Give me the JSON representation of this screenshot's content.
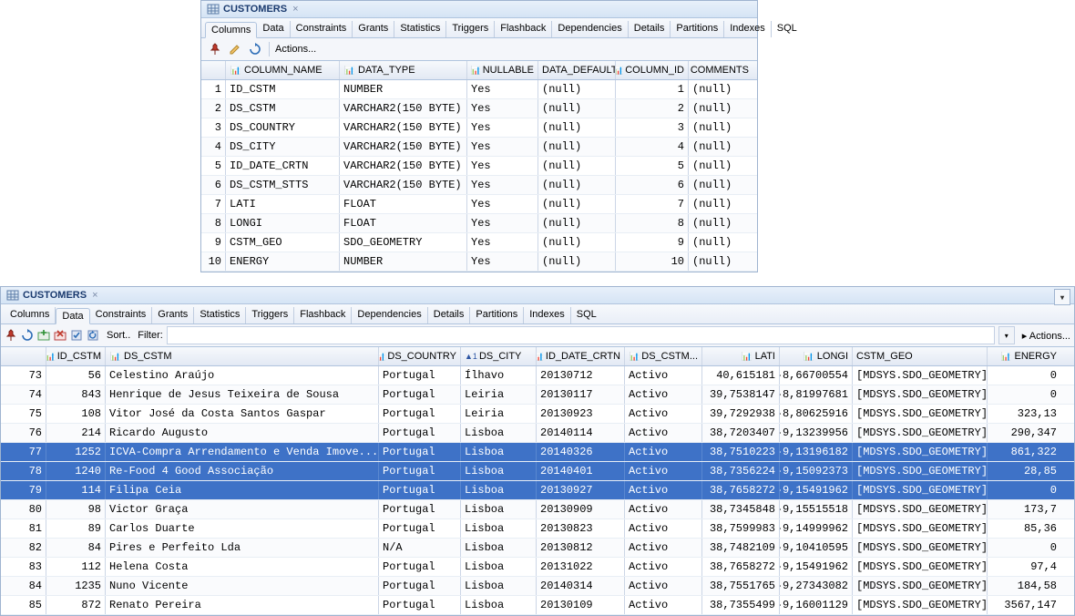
{
  "panel1": {
    "title": "CUSTOMERS",
    "tabs": [
      "Columns",
      "Data",
      "Constraints",
      "Grants",
      "Statistics",
      "Triggers",
      "Flashback",
      "Dependencies",
      "Details",
      "Partitions",
      "Indexes",
      "SQL"
    ],
    "active_tab": 0,
    "actions_label": "Actions...",
    "headers": [
      "COLUMN_NAME",
      "DATA_TYPE",
      "NULLABLE",
      "DATA_DEFAULT",
      "COLUMN_ID",
      "COMMENTS"
    ],
    "rows": [
      {
        "n": "1",
        "name": "ID_CSTM",
        "type": "NUMBER",
        "nullable": "Yes",
        "def": "(null)",
        "cid": "1",
        "cmt": "(null)"
      },
      {
        "n": "2",
        "name": "DS_CSTM",
        "type": "VARCHAR2(150 BYTE)",
        "nullable": "Yes",
        "def": "(null)",
        "cid": "2",
        "cmt": "(null)"
      },
      {
        "n": "3",
        "name": "DS_COUNTRY",
        "type": "VARCHAR2(150 BYTE)",
        "nullable": "Yes",
        "def": "(null)",
        "cid": "3",
        "cmt": "(null)"
      },
      {
        "n": "4",
        "name": "DS_CITY",
        "type": "VARCHAR2(150 BYTE)",
        "nullable": "Yes",
        "def": "(null)",
        "cid": "4",
        "cmt": "(null)"
      },
      {
        "n": "5",
        "name": "ID_DATE_CRTN",
        "type": "VARCHAR2(150 BYTE)",
        "nullable": "Yes",
        "def": "(null)",
        "cid": "5",
        "cmt": "(null)"
      },
      {
        "n": "6",
        "name": "DS_CSTM_STTS",
        "type": "VARCHAR2(150 BYTE)",
        "nullable": "Yes",
        "def": "(null)",
        "cid": "6",
        "cmt": "(null)"
      },
      {
        "n": "7",
        "name": "LATI",
        "type": "FLOAT",
        "nullable": "Yes",
        "def": "(null)",
        "cid": "7",
        "cmt": "(null)"
      },
      {
        "n": "8",
        "name": "LONGI",
        "type": "FLOAT",
        "nullable": "Yes",
        "def": "(null)",
        "cid": "8",
        "cmt": "(null)"
      },
      {
        "n": "9",
        "name": "CSTM_GEO",
        "type": "SDO_GEOMETRY",
        "nullable": "Yes",
        "def": "(null)",
        "cid": "9",
        "cmt": "(null)"
      },
      {
        "n": "10",
        "name": "ENERGY",
        "type": "NUMBER",
        "nullable": "Yes",
        "def": "(null)",
        "cid": "10",
        "cmt": "(null)"
      }
    ]
  },
  "panel2": {
    "title": "CUSTOMERS",
    "tabs": [
      "Columns",
      "Data",
      "Constraints",
      "Grants",
      "Statistics",
      "Triggers",
      "Flashback",
      "Dependencies",
      "Details",
      "Partitions",
      "Indexes",
      "SQL"
    ],
    "active_tab": 1,
    "sort_label": "Sort..",
    "filter_label": "Filter:",
    "actions_label": "Actions...",
    "headers": [
      "ID_CSTM",
      "DS_CSTM",
      "DS_COUNTRY",
      "DS_CITY",
      "ID_DATE_CRTN",
      "DS_CSTM...",
      "LATI",
      "LONGI",
      "CSTM_GEO",
      "ENERGY"
    ],
    "sort_indicator": {
      "col": 3,
      "text": "1"
    },
    "rows": [
      {
        "rn": "73",
        "id": "56",
        "ds": "Celestino Araújo",
        "country": "Portugal",
        "city": "Ílhavo",
        "date": "20130712",
        "stts": "Activo",
        "lati": "40,615181",
        "longi": "-8,66700554",
        "geo": "[MDSYS.SDO_GEOMETRY]",
        "energy": "0",
        "sel": false
      },
      {
        "rn": "74",
        "id": "843",
        "ds": "Henrique de Jesus Teixeira de Sousa",
        "country": "Portugal",
        "city": "Leiria",
        "date": "20130117",
        "stts": "Activo",
        "lati": "39,7538147",
        "longi": "-8,81997681",
        "geo": "[MDSYS.SDO_GEOMETRY]",
        "energy": "0",
        "sel": false
      },
      {
        "rn": "75",
        "id": "108",
        "ds": "Vitor José da Costa Santos Gaspar",
        "country": "Portugal",
        "city": "Leiria",
        "date": "20130923",
        "stts": "Activo",
        "lati": "39,7292938",
        "longi": "-8,80625916",
        "geo": "[MDSYS.SDO_GEOMETRY]",
        "energy": "323,13",
        "sel": false
      },
      {
        "rn": "76",
        "id": "214",
        "ds": "Ricardo Augusto",
        "country": "Portugal",
        "city": "Lisboa",
        "date": "20140114",
        "stts": "Activo",
        "lati": "38,7203407",
        "longi": "-9,13239956",
        "geo": "[MDSYS.SDO_GEOMETRY]",
        "energy": "290,347",
        "sel": false
      },
      {
        "rn": "77",
        "id": "1252",
        "ds": "ICVA-Compra Arrendamento e Venda Imove...",
        "country": "Portugal",
        "city": "Lisboa",
        "date": "20140326",
        "stts": "Activo",
        "lati": "38,7510223",
        "longi": "-9,13196182",
        "geo": "[MDSYS.SDO_GEOMETRY]",
        "energy": "861,322",
        "sel": true
      },
      {
        "rn": "78",
        "id": "1240",
        "ds": "Re-Food 4 Good Associação",
        "country": "Portugal",
        "city": "Lisboa",
        "date": "20140401",
        "stts": "Activo",
        "lati": "38,7356224",
        "longi": "-9,15092373",
        "geo": "[MDSYS.SDO_GEOMETRY]",
        "energy": "28,85",
        "sel": true
      },
      {
        "rn": "79",
        "id": "114",
        "ds": "Filipa Ceia",
        "country": "Portugal",
        "city": "Lisboa",
        "date": "20130927",
        "stts": "Activo",
        "lati": "38,7658272",
        "longi": "-9,15491962",
        "geo": "[MDSYS.SDO_GEOMETRY]",
        "energy": "0",
        "sel": true
      },
      {
        "rn": "80",
        "id": "98",
        "ds": "Victor Graça",
        "country": "Portugal",
        "city": "Lisboa",
        "date": "20130909",
        "stts": "Activo",
        "lati": "38,7345848",
        "longi": "-9,15515518",
        "geo": "[MDSYS.SDO_GEOMETRY]",
        "energy": "173,7",
        "sel": false
      },
      {
        "rn": "81",
        "id": "89",
        "ds": "Carlos Duarte",
        "country": "Portugal",
        "city": "Lisboa",
        "date": "20130823",
        "stts": "Activo",
        "lati": "38,7599983",
        "longi": "-9,14999962",
        "geo": "[MDSYS.SDO_GEOMETRY]",
        "energy": "85,36",
        "sel": false
      },
      {
        "rn": "82",
        "id": "84",
        "ds": "Pires e Perfeito Lda",
        "country": "N/A",
        "city": "Lisboa",
        "date": "20130812",
        "stts": "Activo",
        "lati": "38,7482109",
        "longi": "-9,10410595",
        "geo": "[MDSYS.SDO_GEOMETRY]",
        "energy": "0",
        "sel": false
      },
      {
        "rn": "83",
        "id": "112",
        "ds": "Helena Costa",
        "country": "Portugal",
        "city": "Lisboa",
        "date": "20131022",
        "stts": "Activo",
        "lati": "38,7658272",
        "longi": "-9,15491962",
        "geo": "[MDSYS.SDO_GEOMETRY]",
        "energy": "97,4",
        "sel": false
      },
      {
        "rn": "84",
        "id": "1235",
        "ds": "Nuno Vicente",
        "country": "Portugal",
        "city": "Lisboa",
        "date": "20140314",
        "stts": "Activo",
        "lati": "38,7551765",
        "longi": "-9,27343082",
        "geo": "[MDSYS.SDO_GEOMETRY]",
        "energy": "184,58",
        "sel": false
      },
      {
        "rn": "85",
        "id": "872",
        "ds": "Renato Pereira",
        "country": "Portugal",
        "city": "Lisboa",
        "date": "20130109",
        "stts": "Activo",
        "lati": "38,7355499",
        "longi": "-9,16001129",
        "geo": "[MDSYS.SDO_GEOMETRY]",
        "energy": "3567,147",
        "sel": false
      }
    ]
  }
}
